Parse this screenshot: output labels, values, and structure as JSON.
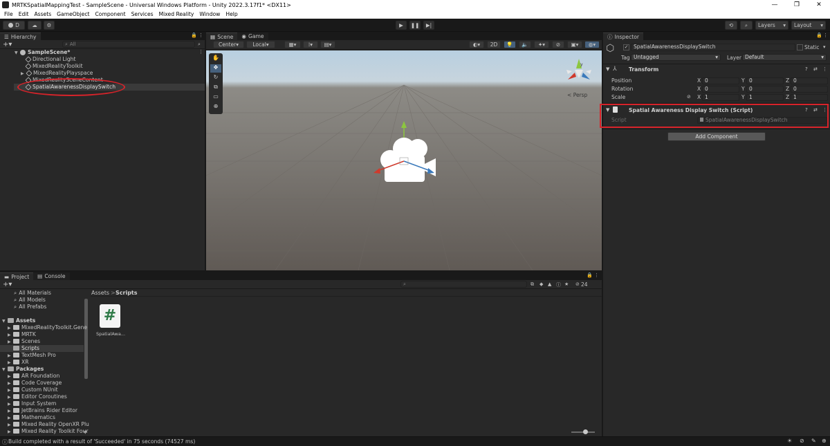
{
  "window": {
    "title": "MRTKSpatialMappingTest - SampleScene - Universal Windows Platform - Unity 2022.3.17f1* <DX11>",
    "minimize": "—",
    "maximize": "❐",
    "close": "✕"
  },
  "menu": [
    "File",
    "Edit",
    "Assets",
    "GameObject",
    "Component",
    "Services",
    "Mixed Reality",
    "Window",
    "Help"
  ],
  "toolbar": {
    "account": "D",
    "layers": "Layers",
    "layout": "Layout"
  },
  "hierarchy": {
    "tab": "Hierarchy",
    "search_placeholder": "All",
    "scene": "SampleScene*",
    "items": [
      "Directional Light",
      "MixedRealityToolkit",
      "MixedRealityPlayspace",
      "MixedRealitySceneContent",
      "SpatialAwarenessDisplaySwitch"
    ]
  },
  "scene": {
    "tabs": [
      "Scene",
      "Game"
    ],
    "pivot": "Center",
    "space": "Local",
    "mode2d": "2D",
    "persp": "Persp"
  },
  "inspector": {
    "tab": "Inspector",
    "object_name": "SpatialAwarenessDisplaySwitch",
    "static_label": "Static",
    "tag_label": "Tag",
    "tag_value": "Untagged",
    "layer_label": "Layer",
    "layer_value": "Default",
    "transform": {
      "title": "Transform",
      "position_label": "Position",
      "rotation_label": "Rotation",
      "scale_label": "Scale",
      "position": {
        "x": "0",
        "y": "0",
        "z": "0"
      },
      "rotation": {
        "x": "0",
        "y": "0",
        "z": "0"
      },
      "scale": {
        "x": "1",
        "y": "1",
        "z": "1"
      }
    },
    "script_component": {
      "title": "Spatial Awareness Display Switch (Script)",
      "script_label": "Script",
      "script_value": "SpatialAwarenessDisplaySwitch"
    },
    "add_component": "Add Component"
  },
  "project": {
    "tabs": [
      "Project",
      "Console"
    ],
    "favorites": [
      "All Materials",
      "All Models",
      "All Prefabs"
    ],
    "assets_root": "Assets",
    "assets": [
      "MixedRealityToolkit.Gene",
      "MRTK",
      "Scenes",
      "Scripts",
      "TextMesh Pro",
      "XR"
    ],
    "packages_root": "Packages",
    "packages": [
      "AR Foundation",
      "Code Coverage",
      "Custom NUnit",
      "Editor Coroutines",
      "Input System",
      "JetBrains Rider Editor",
      "Mathematics",
      "Mixed Reality OpenXR Plu",
      "Mixed Reality Toolkit Four"
    ],
    "breadcrumb_root": "Assets",
    "breadcrumb_current": "Scripts",
    "breadcrumb_sep": ">",
    "hidden_count": "24",
    "file_name": "SpatialAwa...",
    "file_glyph": "#"
  },
  "axes": {
    "x": "X",
    "y": "Y",
    "z": "Z"
  },
  "status": {
    "message": "Build completed with a result of 'Succeeded' in 75 seconds (74527 ms)"
  },
  "colors": {
    "highlight": "#d8232a",
    "accent": "#3a79bb"
  }
}
